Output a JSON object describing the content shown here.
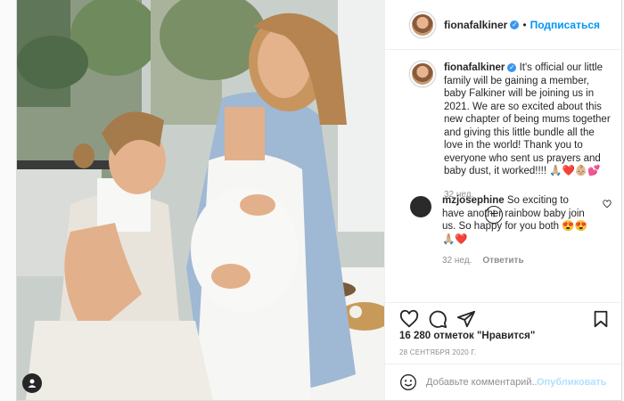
{
  "post": {
    "username": "fionafalkiner",
    "follow_label": "Подписаться",
    "caption": "It's official our little family will be gaining a member, baby Falkiner will be joining us in 2021. We are so excited about this new chapter of being mums together and giving this little bundle all the love in the world! Thank you to everyone who sent us prayers and baby dust, it worked!!!! 🙏🏼❤️👶🏼💕",
    "caption_time": "32 нед.",
    "load_more_label": "+",
    "likes": "16 280 отметок \"Нравится\"",
    "date": "28 СЕНТЯБРЯ 2020 Г."
  },
  "comment": {
    "username": "mzjosephine",
    "text": "So exciting to have another rainbow baby join us. So happy for you both 😍😍🙏🏼❤️",
    "time": "32 нед.",
    "reply_label": "Ответить"
  },
  "compose": {
    "placeholder": "Добавьте комментарий...",
    "publish_label": "Опубликовать"
  },
  "icons": {
    "like": "heart-icon",
    "comment": "comment-icon",
    "share": "paper-plane-icon",
    "save": "bookmark-icon",
    "emoji": "smiley-icon",
    "verified": "verified-badge-icon"
  },
  "colors": {
    "link_blue": "#0095f6",
    "verified_blue": "#3897f0",
    "muted_text": "#8e8e8e",
    "publish_disabled": "#b2dffc"
  }
}
